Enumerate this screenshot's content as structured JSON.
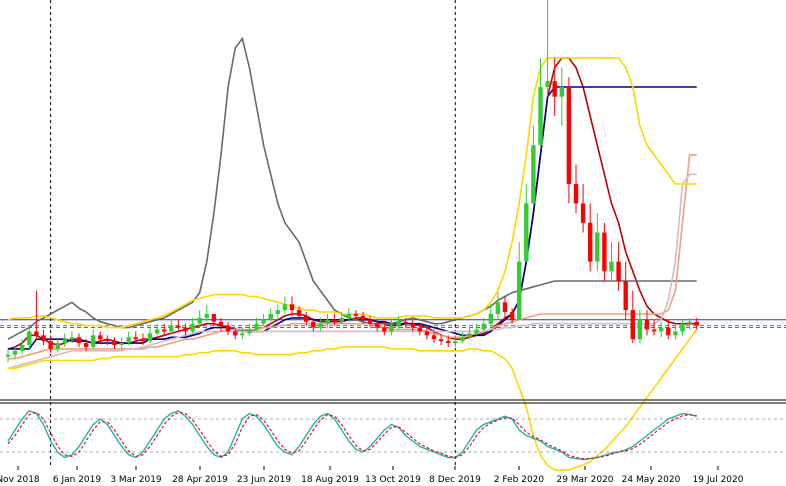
{
  "chart_data": {
    "type": "candlestick",
    "xlabel": "",
    "ylabel": "",
    "x_tick_labels": [
      "Nov 2018",
      "6 Jan 2019",
      "3 Mar 2019",
      "28 Apr 2019",
      "23 Jun 2019",
      "18 Aug 2019",
      "13 Oct 2019",
      "8 Dec 2019",
      "2 Feb 2020",
      "29 Mar 2020",
      "24 May 2020",
      "19 Jul 2020"
    ],
    "vertical_separators_at_week": [
      6,
      63
    ],
    "horizontal_levels": {
      "blue_line": 60,
      "blue_dashed": 54,
      "green_dashed": 52
    },
    "ylim": [
      0,
      400
    ],
    "weeks": 98,
    "candles": {
      "open": [
        22,
        24,
        28,
        34,
        48,
        44,
        38,
        30,
        36,
        40,
        42,
        36,
        32,
        44,
        40,
        38,
        34,
        36,
        42,
        40,
        38,
        46,
        50,
        48,
        54,
        52,
        48,
        56,
        62,
        66,
        58,
        54,
        48,
        44,
        46,
        50,
        56,
        60,
        66,
        70,
        76,
        70,
        64,
        58,
        52,
        56,
        60,
        58,
        62,
        66,
        64,
        60,
        56,
        52,
        48,
        54,
        58,
        56,
        52,
        48,
        44,
        40,
        38,
        36,
        38,
        42,
        46,
        50,
        56,
        66,
        78,
        68,
        60,
        120,
        180,
        240,
        300,
        306,
        290,
        300,
        200,
        180,
        160,
        120,
        150,
        110,
        120,
        100,
        70,
        40,
        60,
        50,
        48,
        52,
        44,
        48,
        56,
        58
      ],
      "close": [
        24,
        28,
        34,
        48,
        44,
        38,
        30,
        36,
        40,
        42,
        36,
        32,
        44,
        40,
        38,
        34,
        36,
        42,
        40,
        38,
        46,
        50,
        48,
        54,
        52,
        48,
        56,
        62,
        66,
        58,
        54,
        48,
        44,
        46,
        50,
        56,
        60,
        66,
        70,
        76,
        70,
        64,
        58,
        52,
        56,
        60,
        58,
        62,
        66,
        64,
        60,
        56,
        52,
        48,
        54,
        58,
        56,
        52,
        48,
        44,
        40,
        38,
        36,
        38,
        42,
        46,
        50,
        56,
        66,
        78,
        68,
        60,
        120,
        180,
        240,
        300,
        306,
        290,
        300,
        200,
        180,
        160,
        120,
        150,
        110,
        120,
        100,
        70,
        40,
        60,
        50,
        48,
        52,
        44,
        48,
        56,
        58,
        54
      ],
      "high": [
        30,
        32,
        40,
        55,
        90,
        50,
        44,
        40,
        46,
        48,
        46,
        40,
        50,
        48,
        44,
        42,
        42,
        48,
        48,
        46,
        52,
        56,
        56,
        60,
        60,
        56,
        62,
        70,
        75,
        66,
        62,
        58,
        52,
        52,
        56,
        62,
        66,
        72,
        76,
        84,
        84,
        74,
        68,
        62,
        62,
        66,
        66,
        68,
        72,
        70,
        68,
        64,
        60,
        58,
        60,
        64,
        62,
        60,
        56,
        52,
        50,
        46,
        44,
        44,
        48,
        52,
        56,
        62,
        76,
        88,
        84,
        72,
        140,
        200,
        260,
        330,
        420,
        330,
        320,
        310,
        220,
        200,
        180,
        170,
        160,
        140,
        140,
        120,
        90,
        70,
        70,
        60,
        58,
        60,
        56,
        60,
        62,
        62
      ],
      "low": [
        16,
        20,
        24,
        30,
        40,
        34,
        26,
        26,
        32,
        36,
        32,
        28,
        30,
        36,
        34,
        30,
        30,
        34,
        36,
        34,
        36,
        44,
        44,
        46,
        48,
        44,
        46,
        54,
        58,
        54,
        48,
        44,
        40,
        40,
        44,
        48,
        54,
        58,
        62,
        66,
        64,
        60,
        54,
        48,
        48,
        52,
        54,
        56,
        58,
        60,
        56,
        52,
        48,
        44,
        44,
        50,
        52,
        48,
        44,
        40,
        36,
        34,
        32,
        32,
        36,
        40,
        44,
        48,
        52,
        60,
        60,
        56,
        100,
        160,
        220,
        280,
        290,
        270,
        260,
        180,
        170,
        150,
        110,
        110,
        100,
        100,
        90,
        60,
        36,
        36,
        44,
        44,
        42,
        40,
        40,
        44,
        50,
        50
      ]
    },
    "series": [
      {
        "color": "#c00000",
        "values": [
          30,
          32,
          36,
          44,
          44,
          40,
          36,
          34,
          36,
          40,
          40,
          38,
          36,
          38,
          40,
          38,
          36,
          36,
          38,
          40,
          40,
          42,
          44,
          46,
          48,
          50,
          52,
          54,
          56,
          56,
          54,
          52,
          50,
          48,
          48,
          50,
          52,
          56,
          60,
          64,
          66,
          66,
          64,
          60,
          58,
          58,
          58,
          58,
          60,
          62,
          62,
          60,
          58,
          56,
          54,
          54,
          56,
          56,
          54,
          52,
          48,
          44,
          42,
          40,
          40,
          42,
          44,
          46,
          50,
          56,
          62,
          66,
          80,
          120,
          170,
          230,
          290,
          320,
          330,
          330,
          320,
          300,
          270,
          240,
          210,
          180,
          160,
          130,
          110,
          90,
          74,
          66,
          62,
          58,
          56,
          56,
          56,
          56
        ]
      },
      {
        "color": "#00008b",
        "values": [
          30,
          30,
          30,
          30,
          40,
          40,
          40,
          40,
          40,
          38,
          38,
          38,
          36,
          36,
          36,
          36,
          36,
          36,
          36,
          36,
          40,
          40,
          40,
          42,
          42,
          42,
          44,
          46,
          50,
          52,
          52,
          52,
          50,
          50,
          48,
          48,
          48,
          52,
          56,
          60,
          62,
          62,
          62,
          60,
          60,
          60,
          60,
          60,
          60,
          60,
          60,
          60,
          58,
          58,
          56,
          56,
          56,
          56,
          56,
          54,
          52,
          50,
          48,
          46,
          44,
          44,
          44,
          44,
          48,
          54,
          60,
          66,
          80,
          120,
          170,
          230,
          290,
          300,
          300,
          300,
          300,
          300,
          300,
          300,
          300,
          300,
          300,
          300,
          300,
          300,
          300,
          300,
          300,
          300,
          300,
          300,
          300,
          300
        ]
      },
      {
        "color": "#696969",
        "values": [
          40,
          44,
          48,
          52,
          58,
          62,
          66,
          70,
          74,
          78,
          72,
          68,
          62,
          58,
          56,
          54,
          52,
          52,
          54,
          56,
          58,
          60,
          62,
          66,
          70,
          74,
          78,
          88,
          120,
          170,
          230,
          300,
          340,
          350,
          320,
          280,
          240,
          210,
          180,
          160,
          150,
          140,
          120,
          100,
          90,
          80,
          70,
          66,
          62,
          60,
          58,
          56,
          56,
          56,
          56,
          58,
          60,
          62,
          60,
          58,
          56,
          56,
          58,
          60,
          62,
          64,
          66,
          70,
          74,
          80,
          84,
          88,
          90,
          92,
          94,
          96,
          98,
          100,
          100,
          100,
          100,
          100,
          100,
          100,
          100,
          100,
          100,
          100,
          100,
          100,
          100,
          100,
          100,
          100,
          100,
          100,
          100,
          100
        ]
      },
      {
        "color": "#f0a080",
        "values": [
          20,
          20,
          22,
          24,
          26,
          28,
          30,
          30,
          30,
          30,
          30,
          30,
          30,
          30,
          30,
          30,
          30,
          30,
          30,
          30,
          32,
          32,
          34,
          36,
          38,
          40,
          40,
          42,
          44,
          46,
          48,
          50,
          50,
          50,
          50,
          50,
          52,
          52,
          54,
          54,
          56,
          56,
          56,
          56,
          56,
          56,
          56,
          56,
          56,
          56,
          56,
          56,
          54,
          52,
          50,
          50,
          50,
          50,
          50,
          48,
          46,
          44,
          42,
          42,
          42,
          44,
          46,
          48,
          50,
          54,
          56,
          58,
          60,
          62,
          64,
          66,
          66,
          66,
          66,
          66,
          66,
          66,
          66,
          66,
          66,
          66,
          66,
          66,
          66,
          66,
          66,
          66,
          66,
          70,
          90,
          160,
          230,
          230
        ]
      },
      {
        "color": "#d8b8c8",
        "values": [
          10,
          12,
          14,
          16,
          18,
          20,
          22,
          24,
          26,
          28,
          28,
          28,
          28,
          28,
          28,
          28,
          28,
          30,
          30,
          32,
          34,
          36,
          38,
          40,
          42,
          44,
          46,
          48,
          48,
          48,
          48,
          48,
          48,
          48,
          48,
          48,
          48,
          48,
          48,
          48,
          48,
          48,
          48,
          48,
          48,
          48,
          48,
          48,
          48,
          48,
          48,
          48,
          48,
          48,
          48,
          48,
          48,
          48,
          48,
          48,
          48,
          48,
          48,
          48,
          48,
          48,
          48,
          48,
          50,
          50,
          52,
          52,
          54,
          54,
          56,
          56,
          56,
          56,
          56,
          56,
          56,
          56,
          56,
          56,
          56,
          56,
          56,
          56,
          56,
          56,
          56,
          56,
          60,
          80,
          120,
          200,
          210,
          210
        ]
      },
      {
        "color": "#ffd700",
        "values": [
          60,
          62,
          62,
          62,
          64,
          64,
          62,
          60,
          58,
          56,
          56,
          54,
          54,
          54,
          52,
          52,
          52,
          54,
          56,
          58,
          60,
          62,
          64,
          68,
          72,
          76,
          80,
          82,
          84,
          86,
          86,
          86,
          86,
          86,
          84,
          84,
          82,
          80,
          78,
          76,
          74,
          72,
          70,
          70,
          68,
          68,
          68,
          66,
          66,
          66,
          66,
          64,
          62,
          62,
          62,
          62,
          64,
          64,
          64,
          64,
          62,
          62,
          62,
          62,
          62,
          64,
          66,
          70,
          78,
          90,
          110,
          140,
          180,
          230,
          290,
          320,
          330,
          330,
          330,
          330,
          330,
          330,
          330,
          330,
          330,
          330,
          330,
          320,
          300,
          260,
          240,
          230,
          220,
          210,
          200,
          200,
          200,
          200
        ]
      },
      {
        "color": "#ffd700",
        "values": [
          10,
          10,
          12,
          14,
          16,
          18,
          18,
          18,
          18,
          18,
          18,
          18,
          18,
          20,
          20,
          22,
          22,
          22,
          22,
          22,
          22,
          22,
          22,
          22,
          22,
          24,
          24,
          26,
          26,
          28,
          28,
          28,
          28,
          26,
          26,
          24,
          24,
          24,
          24,
          24,
          24,
          26,
          26,
          28,
          28,
          30,
          30,
          32,
          32,
          32,
          32,
          32,
          32,
          32,
          30,
          30,
          30,
          30,
          28,
          28,
          28,
          28,
          28,
          28,
          28,
          30,
          30,
          28,
          28,
          24,
          20,
          10,
          -10,
          -30,
          -60,
          -80,
          -90,
          -95,
          -95,
          -95,
          -92,
          -90,
          -86,
          -80,
          -74,
          -66,
          -58,
          -50,
          -40,
          -30,
          -20,
          -10,
          0,
          10,
          20,
          30,
          40,
          50
        ]
      }
    ],
    "oscillator": {
      "ylim": [
        0,
        100
      ],
      "levels": [
        80,
        20
      ],
      "k_line": {
        "color": "#20b2aa",
        "values": [
          40,
          60,
          80,
          95,
          90,
          70,
          40,
          20,
          10,
          15,
          30,
          50,
          70,
          80,
          70,
          50,
          30,
          15,
          10,
          20,
          40,
          60,
          80,
          90,
          95,
          85,
          70,
          50,
          30,
          15,
          10,
          20,
          50,
          80,
          90,
          85,
          70,
          50,
          30,
          20,
          15,
          30,
          50,
          70,
          85,
          90,
          80,
          60,
          40,
          25,
          20,
          30,
          45,
          60,
          70,
          65,
          50,
          40,
          30,
          25,
          20,
          15,
          10,
          10,
          20,
          40,
          60,
          70,
          75,
          80,
          85,
          80,
          60,
          50,
          45,
          40,
          30,
          25,
          20,
          10,
          8,
          6,
          8,
          10,
          14,
          18,
          20,
          24,
          30,
          40,
          50,
          60,
          70,
          80,
          85,
          90,
          88,
          85
        ]
      },
      "d_line": {
        "color": "#dc143c",
        "values": [
          35,
          50,
          70,
          88,
          92,
          80,
          55,
          30,
          15,
          12,
          20,
          40,
          60,
          75,
          75,
          60,
          40,
          22,
          12,
          15,
          30,
          50,
          70,
          85,
          92,
          90,
          78,
          60,
          40,
          22,
          12,
          15,
          35,
          65,
          85,
          88,
          78,
          60,
          40,
          25,
          18,
          22,
          40,
          60,
          78,
          88,
          85,
          70,
          50,
          32,
          22,
          25,
          38,
          52,
          65,
          66,
          56,
          45,
          35,
          28,
          22,
          18,
          12,
          10,
          15,
          30,
          50,
          65,
          72,
          78,
          82,
          82,
          70,
          56,
          48,
          42,
          34,
          28,
          22,
          14,
          10,
          8,
          8,
          10,
          12,
          16,
          20,
          22,
          26,
          34,
          44,
          54,
          64,
          74,
          80,
          86,
          88,
          86
        ]
      }
    }
  }
}
